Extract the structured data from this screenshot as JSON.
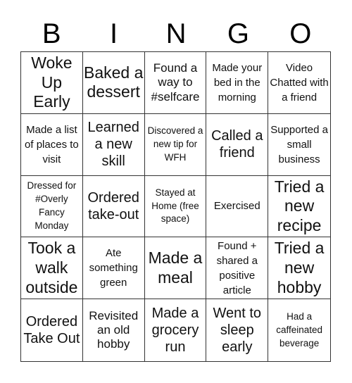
{
  "header": {
    "letters": [
      "B",
      "I",
      "N",
      "G",
      "O"
    ]
  },
  "board": {
    "cells": [
      "Woke Up Early",
      "Baked a dessert",
      "Found a way to #selfcare",
      "Made your bed in the morning",
      "Video Chatted with a friend",
      "Made a list of places to visit",
      "Learned a new skill",
      "Discovered a new tip for WFH",
      "Called a friend",
      "Supported a small business",
      "Dressed for #Overly Fancy Monday",
      "Ordered take-out",
      "Stayed at Home (free space)",
      "Exercised",
      "Tried a new recipe",
      "Took a walk outside",
      "Ate something green",
      "Made a meal",
      "Found + shared a positive article",
      "Tried a new hobby",
      "Ordered Take Out",
      "Revisited an old hobby",
      "Made a grocery run",
      "Went to sleep early",
      "Had a caffeinated beverage"
    ],
    "free_space_index": 12
  }
}
